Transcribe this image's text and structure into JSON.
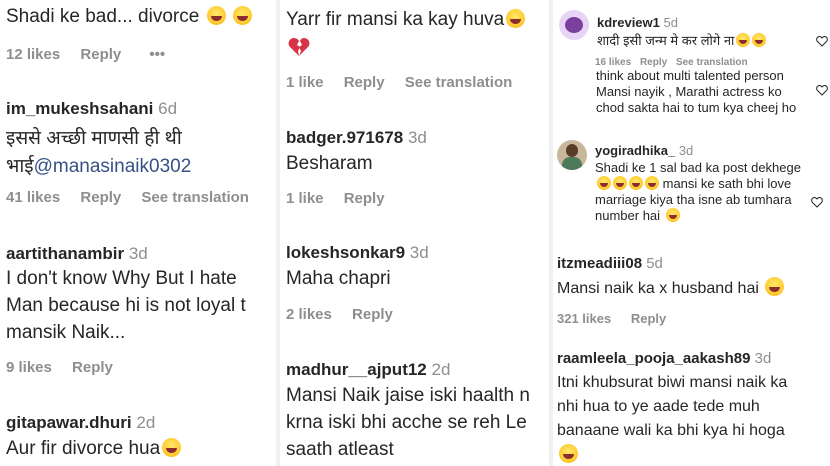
{
  "col1": {
    "c0": {
      "text": "Shadi ke bad... divorce",
      "likes": "12 likes",
      "reply": "Reply",
      "more": "•••"
    },
    "c1": {
      "user": "im_mukeshsahani",
      "time": "6d",
      "line1": "इससे अच्छी माणसी ही थी",
      "line2a": "भाई",
      "mention": "@manasinaik0302",
      "likes": "41 likes",
      "reply": "Reply",
      "translate": "See translation"
    },
    "c2": {
      "user": "aartithanambir",
      "time": "3d",
      "line1": "I don't know Why But I hate",
      "line2": "Man because hi is not loyal t",
      "line3": "mansik Naik...",
      "likes": "9 likes",
      "reply": "Reply"
    },
    "c3": {
      "user": "gitapawar.dhuri",
      "time": "2d",
      "text": "Aur fir divorce hua"
    }
  },
  "col2": {
    "c0": {
      "text": "Yarr fir mansi ka kay huva",
      "likes": "1 like",
      "reply": "Reply",
      "translate": "See translation"
    },
    "c1": {
      "user": "badger.971678",
      "time": "3d",
      "text": "Besharam",
      "likes": "1 like",
      "reply": "Reply"
    },
    "c2": {
      "user": "lokeshsonkar9",
      "time": "3d",
      "text": "Maha chapri",
      "likes": "2 likes",
      "reply": "Reply"
    },
    "c3": {
      "user": "madhur__ajput12",
      "time": "2d",
      "line1": "Mansi Naik jaise iski haalth n",
      "line2": "krna iski bhi acche se reh Le",
      "line3": "saath atleast"
    }
  },
  "col3": {
    "c0": {
      "user": "kdreview1",
      "time": "5d",
      "text": "शादी इसी जन्म मे कर लोगे ना",
      "likes": "16 likes",
      "reply": "Reply",
      "translate": "See translation"
    },
    "c1": {
      "text": "think about multi talented person Mansi nayik , Marathi actress ko chod sakta hai to tum kya cheej ho"
    },
    "c2": {
      "user": "yogiradhika_",
      "time": "3d",
      "text": "Shadi ke 1 sal bad ka post dekhege",
      "text2": "mansi ke sath bhi love marriage kiya tha isne ab tumhara number hai"
    },
    "c3": {
      "user": "itzmeadiii08",
      "time": "5d",
      "text": "Mansi naik ka x husband hai",
      "likes": "321 likes",
      "reply": "Reply"
    },
    "c4": {
      "user": "raamleela_pooja_aakash89",
      "time": "3d",
      "line1": "Itni khubsurat biwi mansi naik ka",
      "line2": "nhi hua to ye aade tede muh",
      "line3": "banaane wali ka bhi kya hi hoga"
    }
  },
  "colors": {
    "text": "#262626",
    "secondary": "#8e8e8e",
    "mention": "#385185",
    "heart": "#d63447"
  }
}
